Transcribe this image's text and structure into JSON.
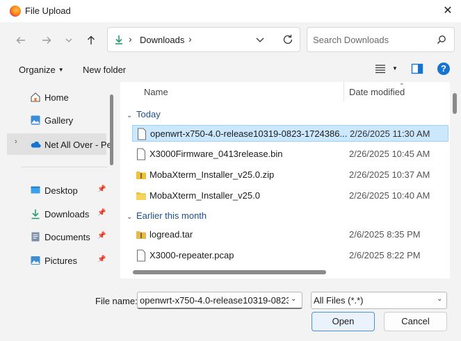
{
  "window": {
    "title": "File Upload",
    "close_glyph": "✕",
    "app_icon": "firefox-icon"
  },
  "nav": {
    "back_glyph": "←",
    "forward_glyph": "→",
    "recent_glyph": "⌄",
    "up_glyph": "↑",
    "breadcrumb_root_glyph": "›",
    "breadcrumb_current": "Downloads",
    "breadcrumb_sep_glyph": "›",
    "address_dropdown_glyph": "⌄",
    "search_placeholder": "Search Downloads"
  },
  "toolbar": {
    "organize_label": "Organize",
    "organize_caret": "▼",
    "new_folder_label": "New folder",
    "view_caret": "▼",
    "help_glyph": "?"
  },
  "sidebar": {
    "items": [
      {
        "label": "Home",
        "icon": "home-icon",
        "pinned": false
      },
      {
        "label": "Gallery",
        "icon": "gallery-icon",
        "pinned": false
      },
      {
        "label": "Net All Over - Pe",
        "icon": "onedrive-icon",
        "pinned": false,
        "selected": true,
        "expander": "›"
      },
      {
        "label": "Desktop",
        "icon": "desktop-icon",
        "pinned": true
      },
      {
        "label": "Downloads",
        "icon": "downloads-icon",
        "pinned": true
      },
      {
        "label": "Documents",
        "icon": "documents-icon",
        "pinned": true
      },
      {
        "label": "Pictures",
        "icon": "pictures-icon",
        "pinned": true
      }
    ],
    "pin_glyph": "📌"
  },
  "file_list": {
    "columns": {
      "name": "Name",
      "date_modified": "Date modified",
      "sort_glyph": "⌄"
    },
    "groups": [
      {
        "label": "Today",
        "chevron": "⌄",
        "files": [
          {
            "name": "openwrt-x750-4.0-release10319-0823-1724386...",
            "date": "2/26/2025 11:30 AM",
            "icon": "file-icon",
            "selected": true
          },
          {
            "name": "X3000Firmware_0413release.bin",
            "date": "2/26/2025 10:45 AM",
            "icon": "file-icon"
          },
          {
            "name": "MobaXterm_Installer_v25.0.zip",
            "date": "2/26/2025 10:37 AM",
            "icon": "zip-folder-icon"
          },
          {
            "name": "MobaXterm_Installer_v25.0",
            "date": "2/26/2025 10:40 AM",
            "icon": "folder-icon"
          }
        ]
      },
      {
        "label": "Earlier this month",
        "chevron": "⌄",
        "files": [
          {
            "name": "logread.tar",
            "date": "2/6/2025 8:35 PM",
            "icon": "archive-icon"
          },
          {
            "name": "X3000-repeater.pcap",
            "date": "2/6/2025 8:22 PM",
            "icon": "file-icon"
          }
        ]
      }
    ]
  },
  "footer": {
    "file_name_label": "File name:",
    "file_name_value": "openwrt-x750-4.0-release10319-0823-",
    "file_name_dropdown_glyph": "⌄",
    "file_type_value": "All Files (*.*)",
    "file_type_dropdown_glyph": "⌄",
    "open_label": "Open",
    "cancel_label": "Cancel"
  },
  "colors": {
    "accent": "#1773d1",
    "selection_bg": "#cce8ff",
    "selection_border": "#99d1ff",
    "group_text": "#1e4f8d",
    "folder_yellow": "#f2c037"
  }
}
